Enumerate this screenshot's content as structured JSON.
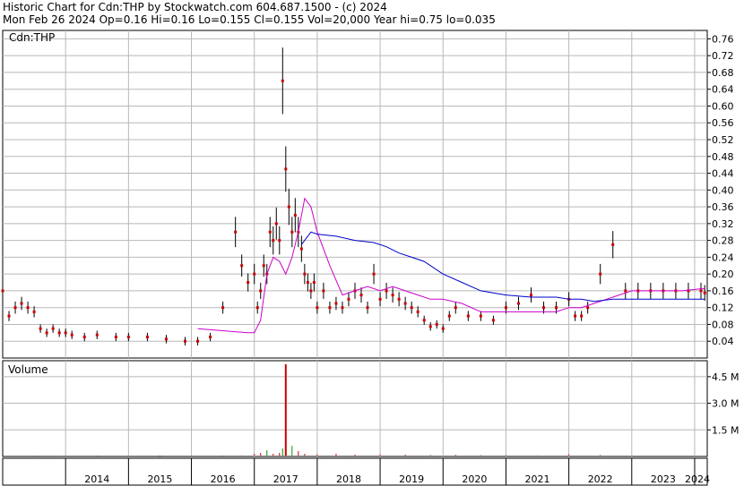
{
  "header": {
    "line1": "Historic Chart for Cdn:THP by Stockwatch.com 604.687.1500 - (c) 2024",
    "line2": "Mon Feb 26 2024   Op=0.16  Hi=0.16  Lo=0.155  Cl=0.155  Vol=20,000  Year hi=0.75  lo=0.035"
  },
  "chart_data": [
    {
      "type": "line",
      "title": "Cdn:THP",
      "ylim": [
        0,
        0.78
      ],
      "yticks": [
        "0.76",
        "0.72",
        "0.68",
        "0.64",
        "0.60",
        "0.56",
        "0.52",
        "0.48",
        "0.44",
        "0.40",
        "0.36",
        "0.32",
        "0.28",
        "0.24",
        "0.20",
        "0.16",
        "0.12",
        "0.08",
        "0.04"
      ],
      "x_years": [
        "2014",
        "2015",
        "2016",
        "2017",
        "2018",
        "2019",
        "2020",
        "2021",
        "2022",
        "2023",
        "2024"
      ],
      "grid": true,
      "series": [
        {
          "name": "",
          "style": "price",
          "color": "#cc0000",
          "x": [
            2013.0,
            2013.1,
            2013.2,
            2013.3,
            2013.4,
            2013.5,
            2013.6,
            2013.7,
            2013.8,
            2013.9,
            2014.0,
            2014.1,
            2014.3,
            2014.5,
            2014.8,
            2015.0,
            2015.3,
            2015.6,
            2015.9,
            2016.1,
            2016.3,
            2016.5,
            2016.7,
            2016.8,
            2016.9,
            2017.0,
            2017.05,
            2017.1,
            2017.15,
            2017.2,
            2017.25,
            2017.3,
            2017.35,
            2017.4,
            2017.45,
            2017.5,
            2017.55,
            2017.6,
            2017.65,
            2017.7,
            2017.75,
            2017.8,
            2017.85,
            2017.9,
            2017.95,
            2018.0,
            2018.1,
            2018.2,
            2018.3,
            2018.4,
            2018.5,
            2018.6,
            2018.7,
            2018.8,
            2018.9,
            2019.0,
            2019.1,
            2019.2,
            2019.3,
            2019.4,
            2019.5,
            2019.6,
            2019.7,
            2019.8,
            2019.9,
            2020.0,
            2020.1,
            2020.2,
            2020.4,
            2020.6,
            2020.8,
            2021.0,
            2021.2,
            2021.4,
            2021.6,
            2021.8,
            2022.0,
            2022.1,
            2022.2,
            2022.3,
            2022.5,
            2022.7,
            2022.9,
            2023.1,
            2023.3,
            2023.5,
            2023.7,
            2023.9,
            2024.1,
            2024.16
          ],
          "y": [
            0.16,
            0.1,
            0.12,
            0.13,
            0.12,
            0.11,
            0.07,
            0.06,
            0.07,
            0.06,
            0.06,
            0.055,
            0.05,
            0.055,
            0.05,
            0.05,
            0.05,
            0.045,
            0.04,
            0.04,
            0.05,
            0.12,
            0.3,
            0.22,
            0.18,
            0.2,
            0.12,
            0.16,
            0.22,
            0.2,
            0.3,
            0.28,
            0.32,
            0.28,
            0.66,
            0.45,
            0.36,
            0.3,
            0.34,
            0.3,
            0.26,
            0.2,
            0.18,
            0.16,
            0.18,
            0.12,
            0.16,
            0.12,
            0.13,
            0.12,
            0.14,
            0.16,
            0.15,
            0.12,
            0.2,
            0.14,
            0.16,
            0.15,
            0.14,
            0.13,
            0.12,
            0.11,
            0.09,
            0.075,
            0.08,
            0.07,
            0.1,
            0.12,
            0.1,
            0.1,
            0.09,
            0.12,
            0.13,
            0.15,
            0.12,
            0.12,
            0.14,
            0.1,
            0.1,
            0.12,
            0.2,
            0.27,
            0.16,
            0.16,
            0.16,
            0.16,
            0.16,
            0.16,
            0.16,
            0.155
          ]
        },
        {
          "name": "",
          "style": "average",
          "color": "#cc00cc",
          "x": [
            2016.1,
            2016.5,
            2016.9,
            2017.0,
            2017.1,
            2017.2,
            2017.3,
            2017.4,
            2017.5,
            2017.6,
            2017.7,
            2017.8,
            2017.9,
            2018.0,
            2018.2,
            2018.4,
            2018.6,
            2018.8,
            2019.0,
            2019.2,
            2019.4,
            2019.6,
            2019.8,
            2020.0,
            2020.3,
            2020.6,
            2021.0,
            2021.4,
            2021.8,
            2022.0,
            2022.2,
            2022.4,
            2022.6,
            2022.8,
            2023.0,
            2023.4,
            2023.8,
            2024.1,
            2024.16
          ],
          "y": [
            0.07,
            0.065,
            0.06,
            0.06,
            0.09,
            0.2,
            0.24,
            0.23,
            0.2,
            0.24,
            0.3,
            0.38,
            0.36,
            0.3,
            0.22,
            0.15,
            0.16,
            0.17,
            0.16,
            0.17,
            0.16,
            0.15,
            0.14,
            0.14,
            0.13,
            0.11,
            0.11,
            0.11,
            0.11,
            0.12,
            0.12,
            0.13,
            0.14,
            0.15,
            0.16,
            0.16,
            0.16,
            0.165,
            0.165
          ]
        },
        {
          "name": "",
          "style": "average",
          "color": "#0000cc",
          "x": [
            2017.75,
            2017.9,
            2018.0,
            2018.3,
            2018.6,
            2018.9,
            2019.1,
            2019.3,
            2019.5,
            2019.7,
            2020.0,
            2020.3,
            2020.6,
            2021.0,
            2021.4,
            2021.8,
            2022.0,
            2022.2,
            2022.4,
            2022.7,
            2023.0,
            2023.4,
            2023.8,
            2024.1,
            2024.16
          ],
          "y": [
            0.27,
            0.3,
            0.295,
            0.29,
            0.28,
            0.275,
            0.265,
            0.25,
            0.24,
            0.23,
            0.2,
            0.18,
            0.16,
            0.15,
            0.145,
            0.145,
            0.14,
            0.14,
            0.135,
            0.14,
            0.14,
            0.14,
            0.14,
            0.14,
            0.14
          ]
        }
      ]
    },
    {
      "type": "bar",
      "title": "Volume",
      "ylim": [
        0,
        5400000
      ],
      "yticks": [
        "4.5 M",
        "3.0 M",
        "1.5 M"
      ],
      "series": [
        {
          "name": "",
          "color": "#cc0000",
          "x": [
            2013.1,
            2013.5,
            2014.0,
            2014.5,
            2015.0,
            2015.5,
            2016.0,
            2016.5,
            2016.8,
            2017.0,
            2017.1,
            2017.2,
            2017.3,
            2017.4,
            2017.45,
            2017.5,
            2017.6,
            2017.7,
            2017.8,
            2018.0,
            2018.3,
            2018.6,
            2019.0,
            2019.4,
            2019.8,
            2020.2,
            2020.6,
            2021.0,
            2021.5,
            2022.0,
            2022.5,
            2023.0,
            2023.5,
            2024.0
          ],
          "y": [
            50000,
            40000,
            30000,
            40000,
            30000,
            30000,
            20000,
            40000,
            60000,
            150000,
            200000,
            350000,
            150000,
            200000,
            450000,
            5200000,
            600000,
            300000,
            150000,
            120000,
            150000,
            100000,
            120000,
            100000,
            80000,
            90000,
            70000,
            80000,
            60000,
            120000,
            80000,
            60000,
            50000,
            40000
          ]
        }
      ]
    }
  ]
}
